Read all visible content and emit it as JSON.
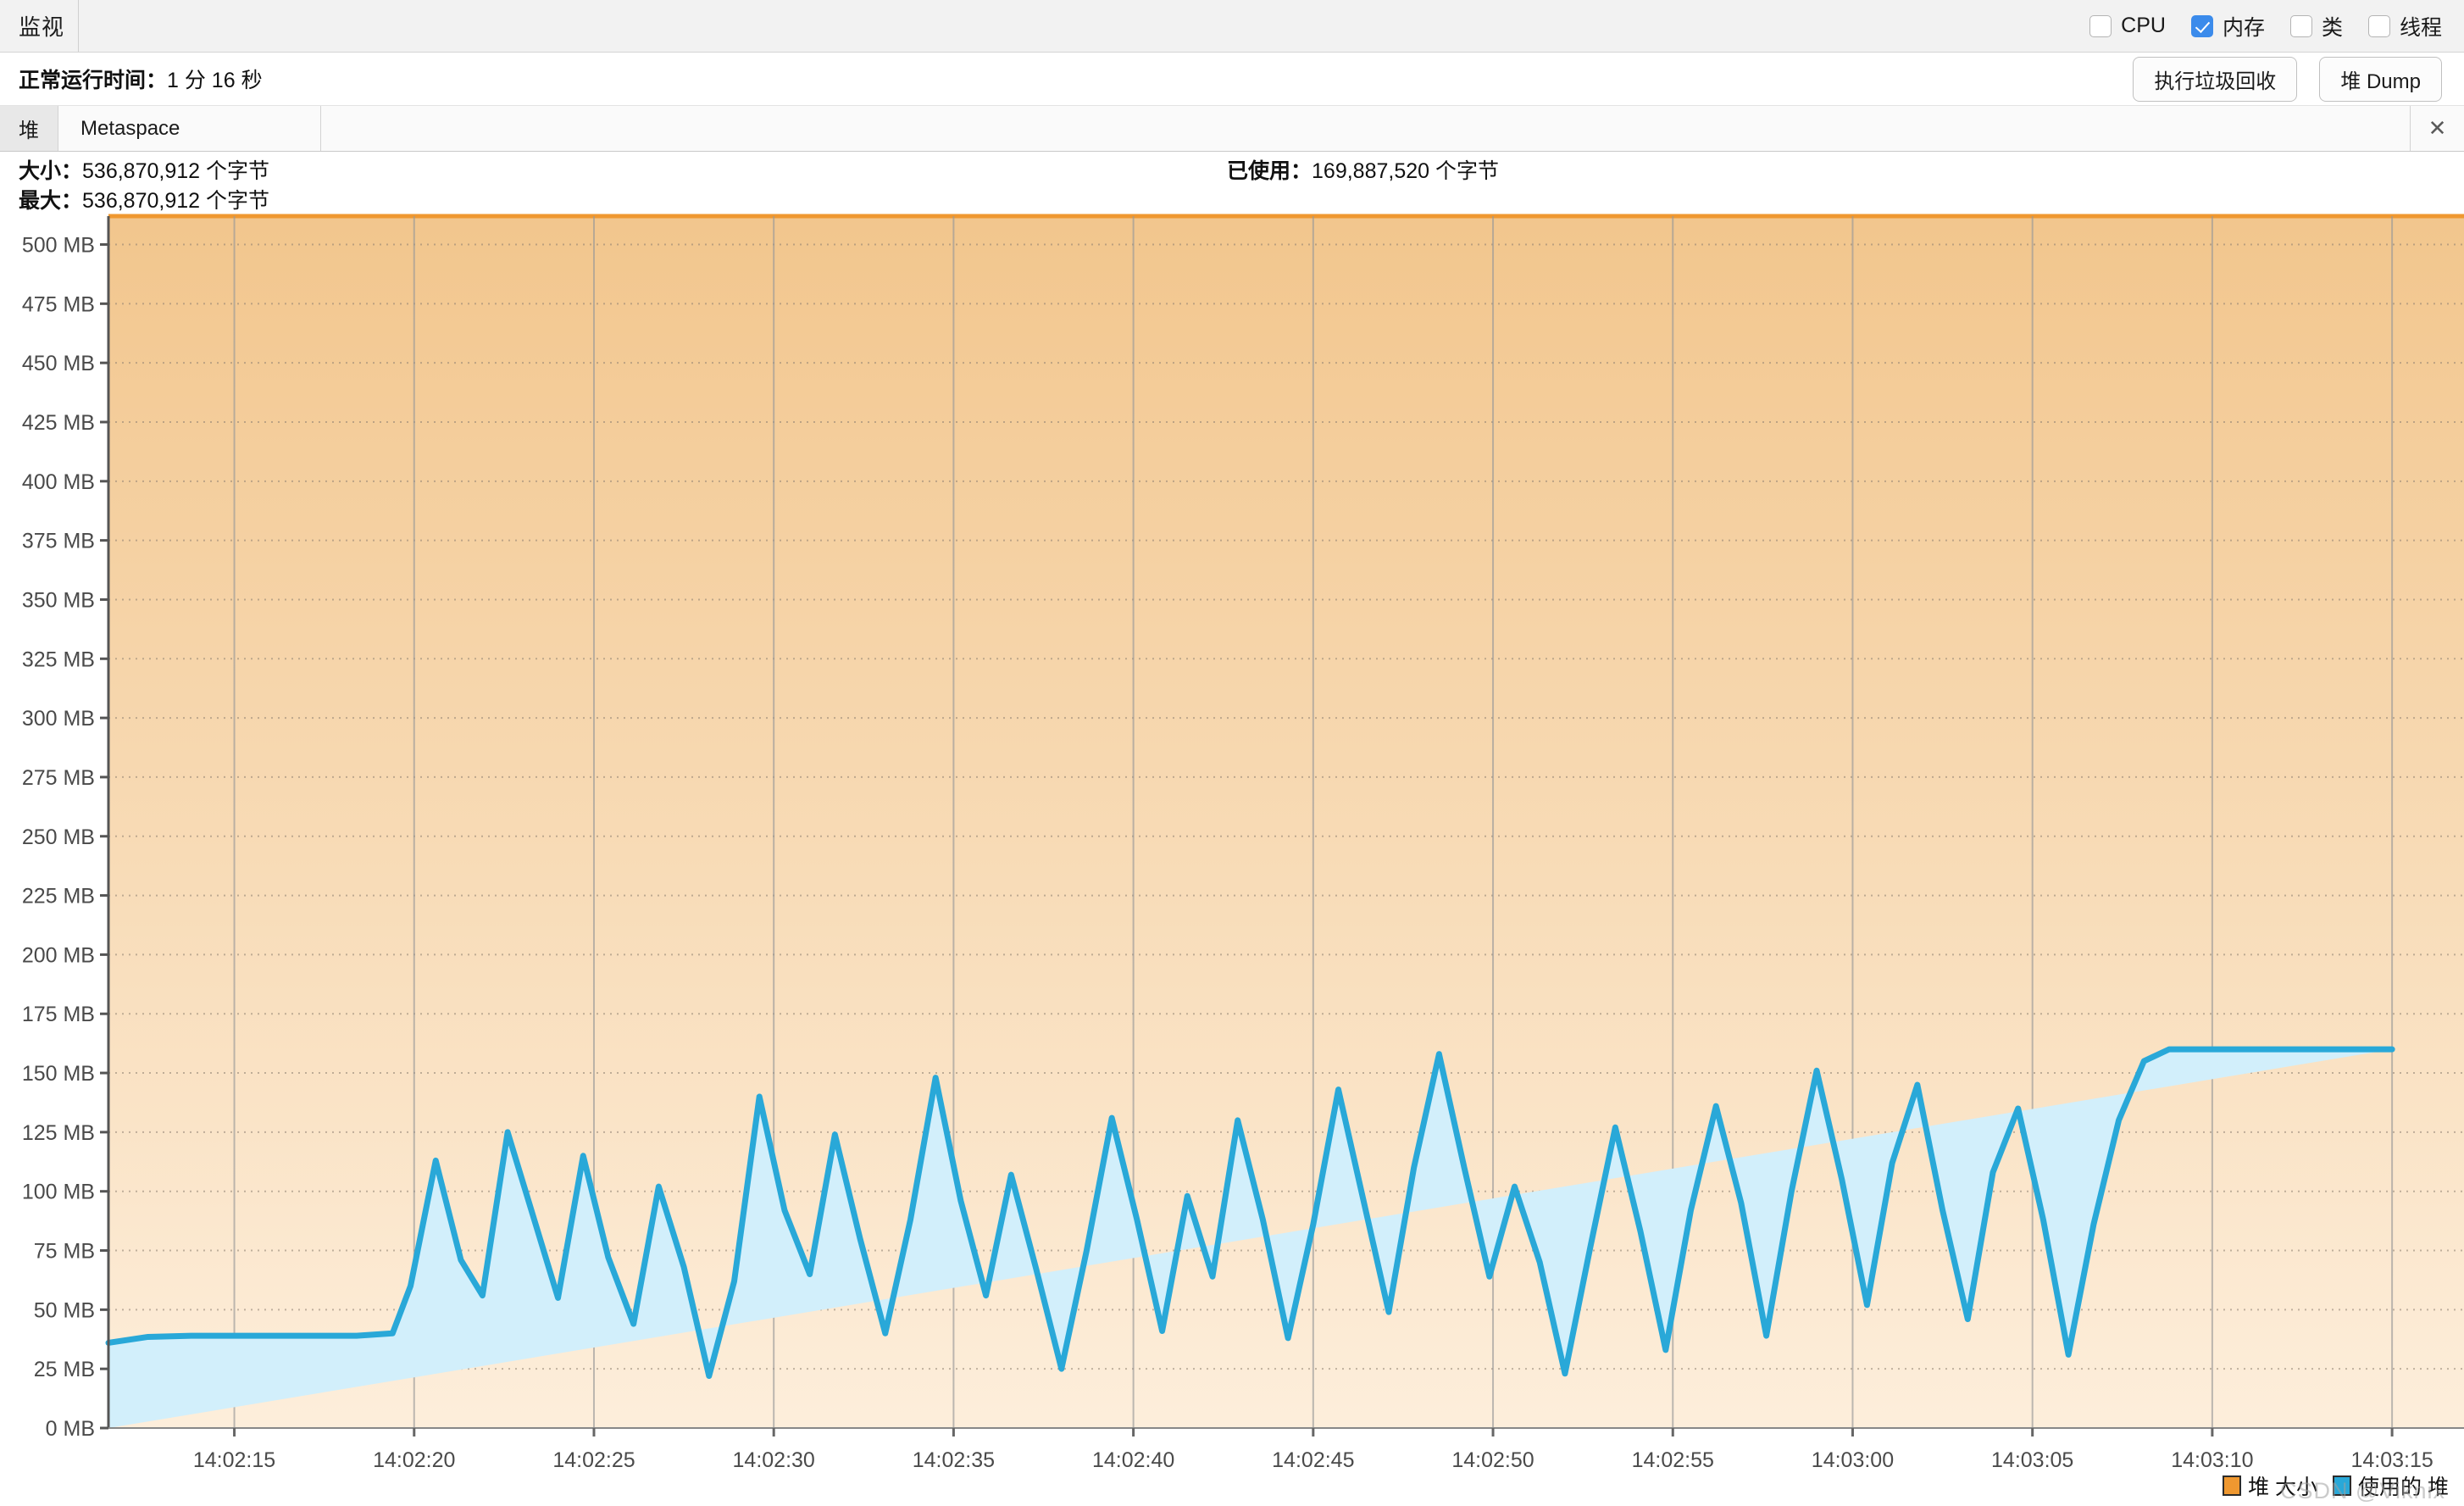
{
  "window": {
    "title": "监视",
    "close_icon": "✕"
  },
  "toggles": [
    {
      "label": "CPU",
      "checked": false,
      "name": "cpu"
    },
    {
      "label": "内存",
      "checked": true,
      "name": "memory"
    },
    {
      "label": "类",
      "checked": false,
      "name": "classes"
    },
    {
      "label": "线程",
      "checked": false,
      "name": "threads"
    }
  ],
  "uptime": {
    "label": "正常运行时间：",
    "value": "1 分 16 秒"
  },
  "actions": {
    "gc_label": "执行垃圾回收",
    "heap_dump_label": "堆 Dump"
  },
  "tabs": [
    {
      "label": "堆",
      "active": true
    },
    {
      "label": "Metaspace",
      "active": false
    }
  ],
  "stats": {
    "size_label": "大小：",
    "size_value": "536,870,912 个字节",
    "max_label": "最大：",
    "max_value": "536,870,912 个字节",
    "used_label": "已使用：",
    "used_value": "169,887,520 个字节"
  },
  "watermark": "CSDN @Viknix",
  "colors": {
    "heap_size_line": "#ef9830",
    "heap_size_fill_top": "#f2c68d",
    "heap_size_fill_bottom": "#fdeedb",
    "used_heap_line": "#29a8d8",
    "used_heap_fill": "#d2effb",
    "accent_checkbox": "#3b8beb"
  },
  "chart_data": {
    "type": "area",
    "title": "",
    "xlabel": "",
    "ylabel": "",
    "grid": true,
    "legend_position": "bottom-right",
    "ylim": [
      0,
      512
    ],
    "y_unit": "MB",
    "y_ticks": [
      0,
      25,
      50,
      75,
      100,
      125,
      150,
      175,
      200,
      225,
      250,
      275,
      300,
      325,
      350,
      375,
      400,
      425,
      450,
      475,
      500
    ],
    "y_tick_labels": [
      "0 MB",
      "25 MB",
      "50 MB",
      "75 MB",
      "100 MB",
      "125 MB",
      "150 MB",
      "175 MB",
      "200 MB",
      "225 MB",
      "250 MB",
      "275 MB",
      "300 MB",
      "325 MB",
      "350 MB",
      "375 MB",
      "400 MB",
      "425 MB",
      "450 MB",
      "475 MB",
      "500 MB"
    ],
    "x_tick_labels": [
      "14:02:15",
      "14:02:20",
      "14:02:25",
      "14:02:30",
      "14:02:35",
      "14:02:40",
      "14:02:45",
      "14:02:50",
      "14:02:55",
      "14:03:00",
      "14:03:05",
      "14:03:10",
      "14:03:15"
    ],
    "x_tick_times": [
      135,
      140,
      145,
      150,
      155,
      160,
      165,
      170,
      175,
      180,
      185,
      190,
      195
    ],
    "xlim": [
      131.5,
      197.0
    ],
    "series": [
      {
        "name": "堆 大小",
        "color": "#ef9830",
        "fill_top": "#f2c68d",
        "fill_bottom": "#fdeedb",
        "x": [
          131.5,
          197.0
        ],
        "values": [
          512,
          512
        ]
      },
      {
        "name": "使用的 堆",
        "color": "#29a8d8",
        "fill": "#d2effb",
        "x": [
          131.5,
          132.6,
          133.8,
          135.2,
          136.8,
          138.4,
          139.4,
          139.9,
          140.6,
          141.3,
          141.9,
          142.6,
          143.3,
          144.0,
          144.7,
          145.4,
          146.1,
          146.8,
          147.5,
          148.2,
          148.9,
          149.6,
          150.3,
          151.0,
          151.7,
          152.4,
          153.1,
          153.8,
          154.5,
          155.2,
          155.9,
          156.6,
          157.3,
          158.0,
          158.7,
          159.4,
          160.1,
          160.8,
          161.5,
          162.2,
          162.9,
          163.6,
          164.3,
          165.0,
          165.7,
          166.4,
          167.1,
          167.8,
          168.5,
          169.2,
          169.9,
          170.6,
          171.3,
          172.0,
          172.7,
          173.4,
          174.1,
          174.8,
          175.5,
          176.2,
          176.9,
          177.6,
          178.3,
          179.0,
          179.7,
          180.4,
          181.1,
          181.8,
          182.5,
          183.2,
          183.9,
          184.6,
          185.3,
          186.0,
          186.7,
          187.4,
          188.1,
          188.8,
          189.5,
          190.2,
          190.9,
          192.0,
          193.4,
          195.0,
          197.0
        ],
        "values": [
          36,
          38.5,
          39,
          39,
          39,
          39,
          40,
          60,
          113,
          71,
          56,
          125,
          90,
          55,
          115,
          72,
          44,
          102,
          68,
          22,
          62,
          140,
          92,
          65,
          124,
          80,
          40,
          88,
          148,
          96,
          56,
          107,
          67,
          25,
          75,
          131,
          88,
          41,
          98,
          64,
          130,
          88,
          38,
          86,
          143,
          96,
          49,
          110,
          158,
          110,
          64,
          102,
          70,
          23,
          76,
          127,
          83,
          33,
          92,
          136,
          95,
          39,
          100,
          151,
          105,
          52,
          112,
          145,
          92,
          46,
          108,
          135,
          88,
          31,
          86,
          130,
          155,
          160,
          160,
          160,
          160,
          160,
          160,
          160
        ]
      }
    ]
  }
}
